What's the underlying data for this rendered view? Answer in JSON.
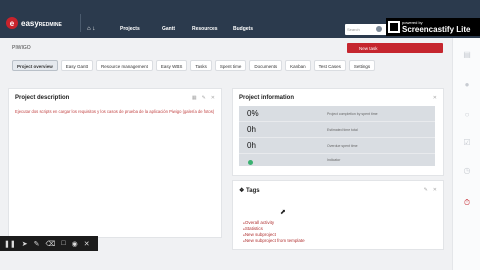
{
  "brand": {
    "logo_letter": "e",
    "name": "easy",
    "name_suffix": "REDMINE"
  },
  "topnav": {
    "home": "⌂ ↓",
    "items": [
      "Projects",
      "Gantt",
      "Resources",
      "Budgets"
    ],
    "search_placeholder": "Search"
  },
  "screencastify": {
    "powered_by": "powered by",
    "name": "Screencastify Lite"
  },
  "breadcrumb": "PIWIGO",
  "new_task_label": "New task",
  "tabs": [
    "Project overview",
    "Easy Gantt",
    "Resource management",
    "Easy WBS",
    "Tasks",
    "Spent time",
    "Documents",
    "Kanban",
    "Test Cases",
    "Settings"
  ],
  "description_panel": {
    "title": "Project description",
    "text": "Ejecutar dos scripts en cargar los requisitos y los casos de prueba de la aplicación Piwigo (galería de fotos)"
  },
  "info_panel": {
    "title": "Project information",
    "rows": [
      {
        "value": "0%",
        "label": "Project completion by spent time"
      },
      {
        "value": "0h",
        "label": "Estimated time total"
      },
      {
        "value": "0h",
        "label": "Overdue spent time"
      },
      {
        "value": "",
        "label": "Indicator"
      }
    ]
  },
  "tags_panel": {
    "title": "Tags",
    "links": [
      "Overall activity",
      "Statistics",
      "New subproject",
      "New subproject from template"
    ]
  },
  "colors": {
    "topbar": "#2b3a4d",
    "accent": "#c5262e"
  }
}
